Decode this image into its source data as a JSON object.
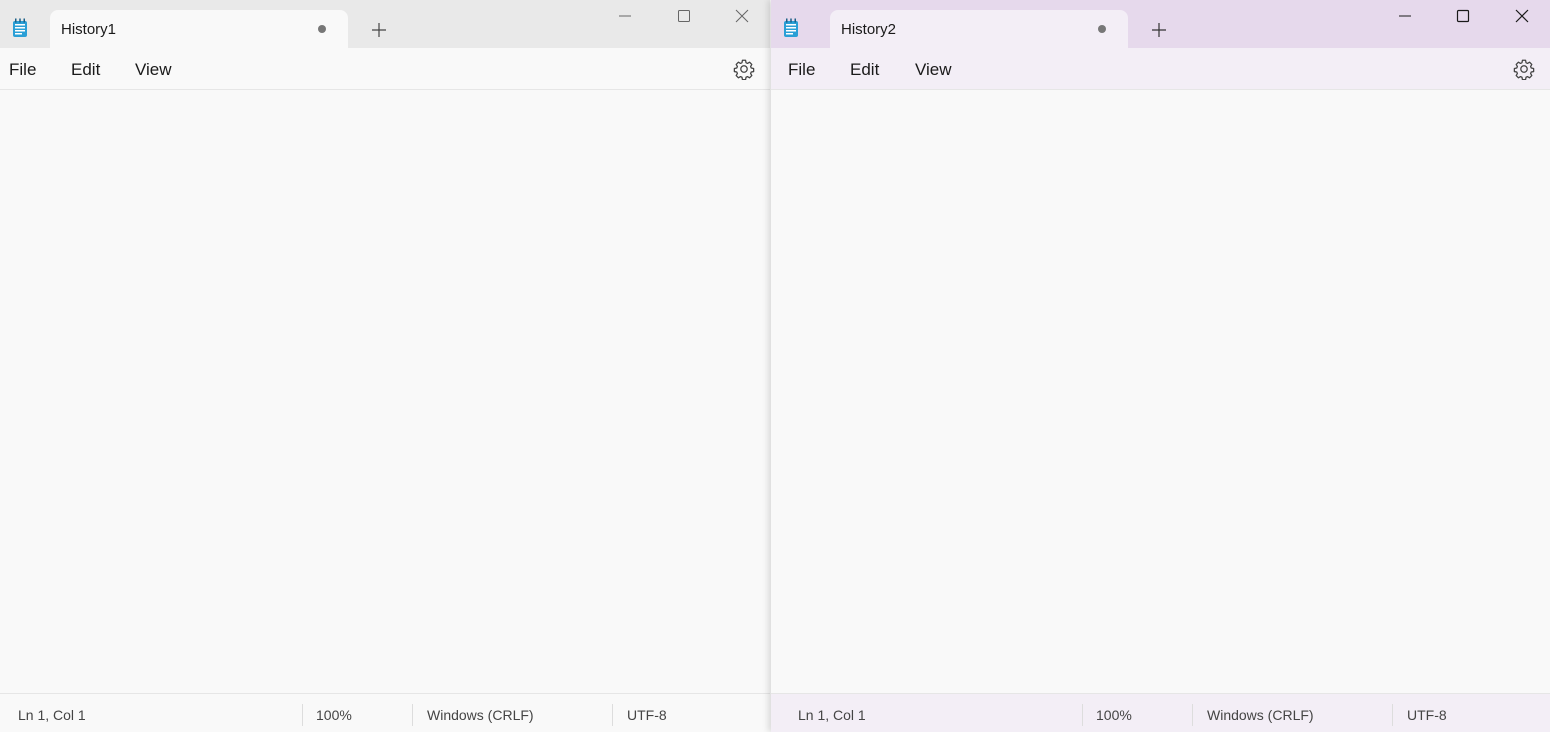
{
  "windows": [
    {
      "tab": {
        "title": "History1",
        "unsaved_indicator": "dot"
      },
      "menu": {
        "file": "File",
        "edit": "Edit",
        "view": "View"
      },
      "status": {
        "position": "Ln 1, Col 1",
        "zoom": "100%",
        "line_ending": "Windows (CRLF)",
        "encoding": "UTF-8"
      },
      "titlebar_color": "#e9e9e9"
    },
    {
      "tab": {
        "title": "History2",
        "unsaved_indicator": "dot"
      },
      "menu": {
        "file": "File",
        "edit": "Edit",
        "view": "View"
      },
      "status": {
        "position": "Ln 1, Col 1",
        "zoom": "100%",
        "line_ending": "Windows (CRLF)",
        "encoding": "UTF-8"
      },
      "titlebar_color": "#e6d9ec"
    }
  ],
  "icons": {
    "app": "notepad-icon",
    "new_tab": "plus-icon",
    "minimize": "minimize-icon",
    "maximize": "maximize-icon",
    "close": "close-icon",
    "settings": "gear-icon"
  }
}
